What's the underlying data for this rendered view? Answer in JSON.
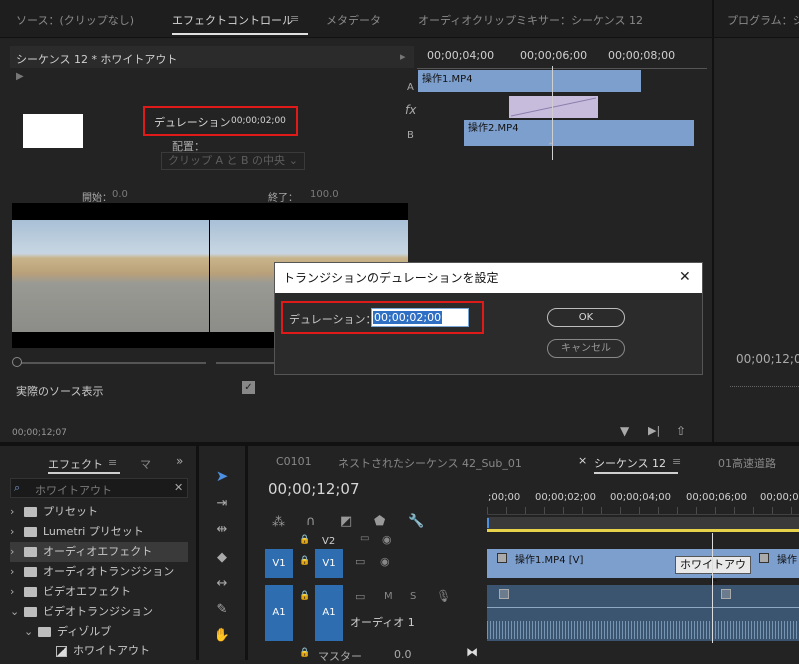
{
  "top_tabs": {
    "source": "ソース：(クリップなし)",
    "effect_controls": "エフェクトコントロール",
    "metadata": "メタデータ",
    "audio_mixer": "オーディオクリップミキサー：シーケンス 12",
    "program": "プログラム：シ"
  },
  "effect_controls": {
    "sequence_title": "シーケンス 12 * ホワイトアウト",
    "duration_label": "デュレーション",
    "duration_value": "00;00;02;00",
    "alignment_label": "配置：",
    "alignment_value": "クリップ A と B の中央",
    "start_label": "開始：",
    "start_value": "0.0",
    "end_label": "終了：",
    "end_value": "100.0",
    "show_actual_sources": "実際のソース表示",
    "timecode": "00;00;12;07",
    "ruler": [
      "00;00;04;00",
      "00;00;06;00",
      "00;00;08;00"
    ],
    "track_a": "A",
    "track_b": "B",
    "fx": "fx",
    "clip_a": "操作1.MP4",
    "clip_b": "操作2.MP4"
  },
  "dialog": {
    "title": "トランジションのデュレーションを設定",
    "close": "✕",
    "duration_label": "デュレーション：",
    "duration_value": "00;00;02;00",
    "ok": "OK",
    "cancel": "キャンセル"
  },
  "program": {
    "timecode": "00;00;12;0"
  },
  "effects_panel": {
    "tab": "エフェクト",
    "tab_menu": "≡",
    "tab2": "マ",
    "search_value": "ホワイトアウト",
    "items": [
      {
        "label": "プリセット",
        "chevron": "›"
      },
      {
        "label": "Lumetri プリセット",
        "chevron": "›"
      },
      {
        "label": "オーディオエフェクト",
        "chevron": "›"
      },
      {
        "label": "オーディオトランジション",
        "chevron": "›"
      },
      {
        "label": "ビデオエフェクト",
        "chevron": "›"
      },
      {
        "label": "ビデオトランジション",
        "chevron": "⌄"
      },
      {
        "label": "ディゾルブ",
        "chevron": "⌄"
      },
      {
        "label": "ホワイトアウト",
        "chevron": ""
      }
    ]
  },
  "timeline": {
    "tabs": [
      "C0101",
      "ネストされたシーケンス 42_Sub_01",
      "シーケンス 12",
      "01高速道路"
    ],
    "close": "×",
    "menu": "≡",
    "timecode": "00;00;12;07",
    "ruler": [
      ";00;00",
      "00;00;02;00",
      "00;00;04;00",
      "00;00;06;00",
      "00;00;08;00"
    ],
    "v2": "V2",
    "v1": "V1",
    "a1": "A1",
    "audio_track_name": "オーディオ 1",
    "master": "マスター",
    "master_value": "0.0",
    "clip_v1": "操作1.MP4 [V]",
    "clip_v1_next": "操作",
    "transition_tooltip": "ホワイトアウト",
    "m": "M",
    "s": "S"
  }
}
